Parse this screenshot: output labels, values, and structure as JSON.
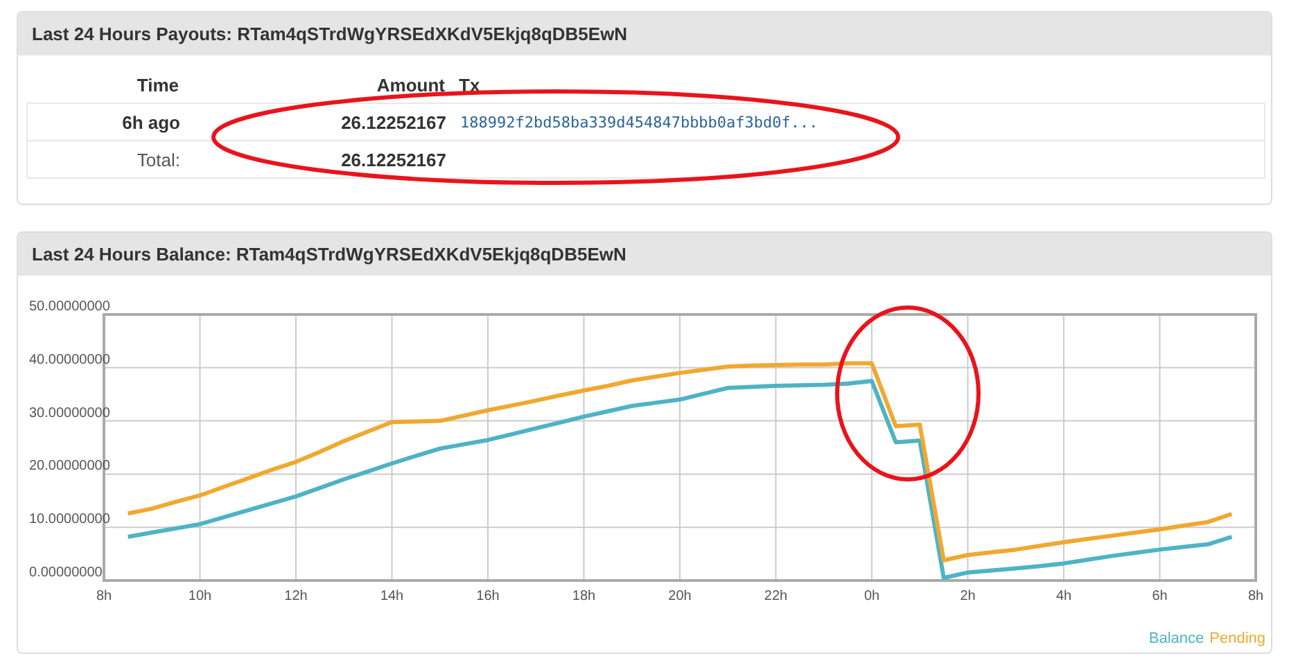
{
  "payouts": {
    "title": "Last 24 Hours Payouts: RTam4qSTrdWgYRSEdXKdV5Ekjq8qDB5EwN",
    "columns": [
      "Time",
      "Amount",
      "Tx"
    ],
    "rows": [
      {
        "time": "6h ago",
        "amount": "26.12252167",
        "tx": "188992f2bd58ba339d454847bbbb0af3bd0f..."
      }
    ],
    "total": {
      "label": "Total:",
      "amount": "26.12252167"
    }
  },
  "balance": {
    "title": "Last 24 Hours Balance: RTam4qSTrdWgYRSEdXKdV5Ekjq8qDB5EwN",
    "chart_data": {
      "type": "line",
      "categories": [
        "8h",
        null,
        null,
        null,
        "10h",
        null,
        null,
        null,
        "12h",
        null,
        null,
        null,
        "14h",
        null,
        null,
        null,
        "16h",
        null,
        null,
        null,
        "18h",
        null,
        null,
        null,
        "20h",
        null,
        null,
        null,
        "22h",
        null,
        null,
        null,
        "0h",
        null,
        null,
        null,
        "2h",
        null,
        null,
        null,
        "4h",
        null,
        null,
        null,
        "6h",
        null,
        null,
        null,
        "8h"
      ],
      "series": [
        {
          "name": "Balance",
          "color": "#4eb3c4",
          "values": [
            null,
            8.2,
            9.0,
            9.8,
            10.6,
            11.9,
            13.2,
            14.5,
            15.8,
            17.4,
            19.0,
            20.5,
            22.0,
            23.4,
            24.8,
            25.6,
            26.4,
            27.5,
            28.6,
            29.7,
            30.8,
            31.8,
            32.8,
            33.4,
            34.0,
            35.1,
            36.2,
            36.4,
            36.6,
            36.7,
            36.8,
            37.0,
            37.5,
            26.0,
            26.3,
            0.5,
            1.5,
            1.9,
            2.3,
            2.7,
            3.2,
            3.9,
            4.6,
            5.2,
            5.8,
            6.3,
            6.8,
            8.2,
            null
          ]
        },
        {
          "name": "Pending",
          "color": "#f0a830",
          "values": [
            null,
            12.6,
            13.5,
            14.8,
            16.0,
            17.6,
            19.2,
            20.8,
            22.3,
            24.2,
            26.2,
            28.0,
            29.8,
            29.9,
            30.0,
            31.0,
            32.0,
            32.9,
            33.8,
            34.8,
            35.7,
            36.6,
            37.6,
            38.3,
            39.0,
            39.6,
            40.2,
            40.4,
            40.5,
            40.6,
            40.6,
            40.8,
            40.8,
            29.0,
            29.3,
            3.8,
            4.8,
            5.3,
            5.8,
            6.5,
            7.2,
            7.8,
            8.4,
            9.0,
            9.6,
            10.3,
            11.0,
            12.5,
            null
          ]
        }
      ],
      "grid": true,
      "ylim": [
        0,
        50
      ],
      "yticks": [
        {
          "value": 0,
          "label": "0.00000000"
        },
        {
          "value": 10,
          "label": "10.00000000"
        },
        {
          "value": 20,
          "label": "20.00000000"
        },
        {
          "value": 30,
          "label": "30.00000000"
        },
        {
          "value": 40,
          "label": "40.00000000"
        },
        {
          "value": 50,
          "label": "50.00000000"
        }
      ]
    }
  }
}
